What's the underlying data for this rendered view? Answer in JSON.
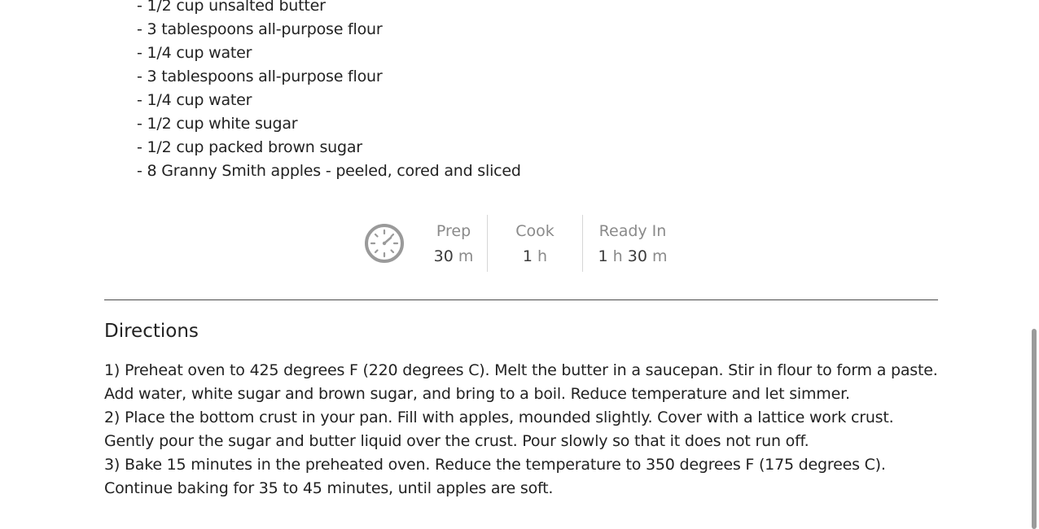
{
  "ingredients": [
    "- 1/2 cup unsalted butter",
    "- 3 tablespoons all-purpose flour",
    "- 1/4 cup water",
    "- 3 tablespoons all-purpose flour",
    "- 1/4 cup water",
    "- 1/2 cup white sugar",
    "- 1/2 cup packed brown sugar",
    "- 8 Granny Smith apples - peeled, cored and sliced"
  ],
  "times": {
    "icon": "clock-icon",
    "prep": {
      "label": "Prep",
      "num": "30",
      "unit": "m"
    },
    "cook": {
      "label": "Cook",
      "num": "1",
      "unit": "h"
    },
    "ready": {
      "label": "Ready In",
      "num1": "1",
      "unit1": "h",
      "num2": "30",
      "unit2": "m"
    }
  },
  "directions": {
    "title": "Directions",
    "steps": [
      "1) Preheat oven to 425 degrees F (220 degrees C). Melt the butter in a saucepan. Stir in flour to form a paste. Add water, white sugar and brown sugar, and bring to a boil. Reduce temperature and let simmer.",
      "2) Place the bottom crust in your pan. Fill with apples, mounded slightly. Cover with a lattice work crust. Gently pour the sugar and butter liquid over the crust. Pour slowly so that it does not run off.",
      "3) Bake 15 minutes in the preheated oven. Reduce the temperature to 350 degrees F (175 degrees C). Continue baking for 35 to 45 minutes, until apples are soft."
    ]
  },
  "colors": {
    "text": "#222222",
    "muted": "#8a8a8a",
    "rule": "#4a4a4a",
    "icon": "#9a9a9a"
  }
}
